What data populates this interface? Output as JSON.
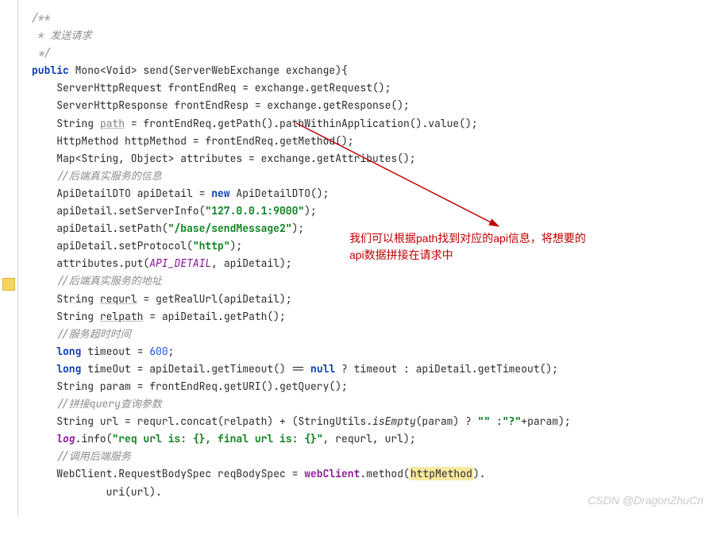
{
  "code": {
    "l1": "/**",
    "l2": " * 发送请求",
    "l3": " */",
    "l4a": "public",
    "l4b": " Mono<Void> send(ServerWebExchange exchange){",
    "l5": "    ServerHttpRequest frontEndReq = exchange.getRequest();",
    "l6": "    ServerHttpResponse frontEndResp = exchange.getResponse();",
    "l7a": "    String ",
    "l7b": "path",
    "l7c": " = frontEndReq.getPath().pathWithinApplication().value();",
    "l8": "",
    "l9": "    HttpMethod httpMethod = frontEndReq.getMethod();",
    "l10": "    Map<String, Object> attributes = exchange.getAttributes();",
    "l11": "    //后端真实服务的信息",
    "l12a": "    ApiDetailDTO apiDetail = ",
    "l12b": "new",
    "l12c": " ApiDetailDTO();",
    "l13a": "    apiDetail.setServerInfo(",
    "l13b": "\"127.0.0.1:9000\"",
    "l13c": ");",
    "l14a": "    apiDetail.setPath(",
    "l14b": "\"/base/sendMessage2\"",
    "l14c": ");",
    "l15a": "    apiDetail.setProtocol(",
    "l15b": "\"http\"",
    "l15c": ");",
    "l16": "",
    "l17a": "    attributes.put(",
    "l17b": "API_DETAIL",
    "l17c": ", apiDetail);",
    "l18": "    //后端真实服务的地址",
    "l19a": "    String ",
    "l19b": "requrl",
    "l19c": " = getRealUrl(apiDetail);",
    "l20": "",
    "l21a": "    String ",
    "l21b": "relpath",
    "l21c": " = apiDetail.getPath();",
    "l22": "    //服务超时时间",
    "l23a": "    ",
    "l23b": "long",
    "l23c": " timeout = ",
    "l23d": "600",
    "l23e": ";",
    "l24a": "    ",
    "l24b": "long",
    "l24c": " timeOut = apiDetail.getTimeout() == ",
    "l24d": "null",
    "l24e": " ? timeout : apiDetail.getTimeout();",
    "l25": "    String param = frontEndReq.getURI().getQuery();",
    "l26": "    //拼接query查询参数",
    "l27a": "    String url = requrl.concat(relpath) + (StringUtils.",
    "l27b": "isEmpty",
    "l27c": "(param) ? ",
    "l27d": "\"\"",
    "l27e": " :",
    "l27f": "\"?\"",
    "l27g": "+param);",
    "l28a": "    ",
    "l28b": "log",
    "l28c": ".info(",
    "l28d": "\"req url is: {}, final url is: {}\"",
    "l28e": ", requrl, url);",
    "l29": "    //调用后端服务",
    "l30a": "    WebClient.RequestBodySpec reqBodySpec = ",
    "l30b": "webClient",
    "l30c": ".method(",
    "l30d": "httpMethod",
    "l30e": ").",
    "l31": "            uri(url)."
  },
  "callout": {
    "line1": "我们可以根据path找到对应的api信息，将想要的",
    "line2": "api数据拼接在请求中"
  },
  "watermark": "CSDN @DragonZhuCn"
}
